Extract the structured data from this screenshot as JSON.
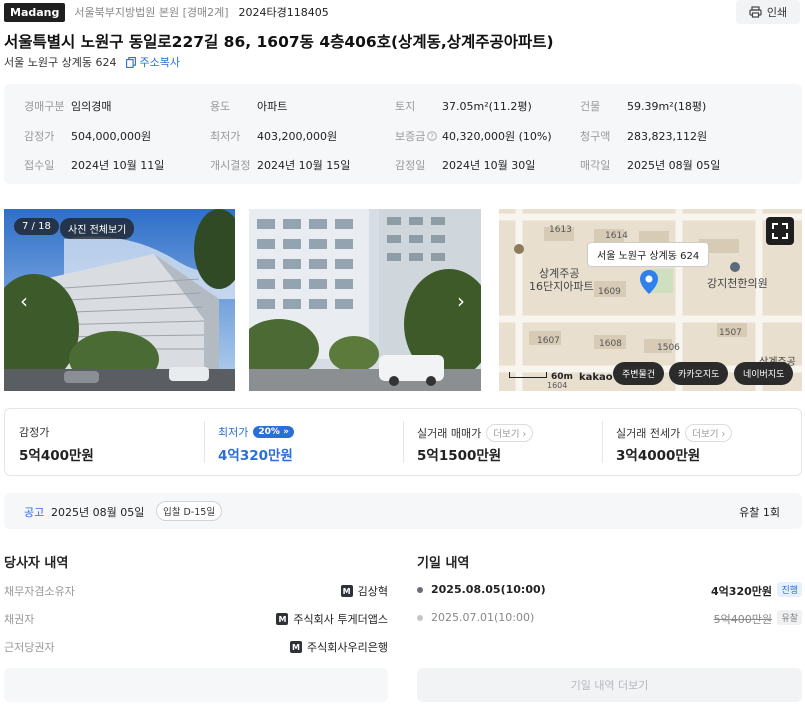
{
  "header": {
    "logo": "Madang",
    "court": "서울북부지방법원 본원 [경매2계]",
    "case_no": "2024타경118405",
    "print_label": "인쇄"
  },
  "title": "서울특별시 노원구 동일로227길 86, 1607동 4층406호(상계동,상계주공아파트)",
  "sub_address": "서울 노원구 상계동 624",
  "copy_label": "주소복사",
  "info": {
    "auction_type_label": "경매구분",
    "auction_type": "임의경매",
    "use_label": "용도",
    "use": "아파트",
    "land_label": "토지",
    "land": "37.05m²(11.2평)",
    "building_label": "건물",
    "building": "59.39m²(18평)",
    "appraisal_label": "감정가",
    "appraisal": "504,000,000원",
    "min_label": "최저가",
    "min": "403,200,000원",
    "deposit_label": "보증금",
    "deposit": "40,320,000원 (10%)",
    "claim_label": "청구액",
    "claim": "283,823,112원",
    "received_label": "접수일",
    "received": "2024년 10월 11일",
    "decision_label": "개시결정",
    "decision": "2024년 10월 15일",
    "appraisal_date_label": "감정일",
    "appraisal_date": "2024년 10월 30일",
    "closing_label": "매각일",
    "closing": "2025년 08월 05일"
  },
  "gallery": {
    "count": "7 / 18",
    "view_all": "사진 전체보기"
  },
  "map": {
    "tooltip": "서울 노원구 상계동 624",
    "labels": [
      "1613",
      "1614",
      "상계주공",
      "16단지아파트",
      "1609",
      "강지천한의원",
      "1607",
      "1608",
      "1506",
      "1507",
      "상계주공",
      "1604"
    ],
    "scale": "60m",
    "brand": "kakao",
    "btn_nearby": "주변물건",
    "btn_kakao": "카카오지도",
    "btn_naver": "네이버지도"
  },
  "prices": {
    "appraisal_label": "감정가",
    "appraisal": "5억400만원",
    "min_label": "최저가",
    "min_pct": "20%",
    "min": "4억320만원",
    "trade_label": "실거래 매매가",
    "trade": "5억1500만원",
    "lease_label": "실거래 전세가",
    "lease": "3억4000만원",
    "more": "더보기"
  },
  "notice": {
    "label": "공고",
    "date": "2025년 08월 05일",
    "dday": "입찰 D-15일",
    "fails": "유찰 1회"
  },
  "parties": {
    "title": "당사자 내역",
    "rows": [
      {
        "role": "채무자겸소유자",
        "badge": "M",
        "name": "김상혁"
      },
      {
        "role": "채권자",
        "badge": "M",
        "name": "주식회사 투게더앱스"
      },
      {
        "role": "근저당권자",
        "badge": "M",
        "name": "주식회사우리은행"
      }
    ]
  },
  "schedule": {
    "title": "기일 내역",
    "rows": [
      {
        "date": "2025.08.05(10:00)",
        "amount": "4억320만원",
        "status": "진행"
      },
      {
        "date": "2025.07.01(10:00)",
        "amount": "5억400만원",
        "status": "유찰"
      }
    ],
    "more": "기일 내역 더보기"
  },
  "colors": {
    "accent": "#2a6fd6",
    "map_marker": "#2f80ed"
  }
}
